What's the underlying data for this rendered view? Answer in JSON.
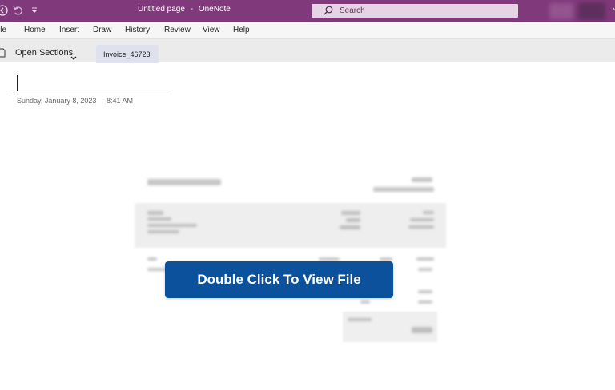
{
  "window": {
    "page_title": "Untitled page",
    "separator": "-",
    "app_name": "OneNote"
  },
  "search": {
    "placeholder": "Search"
  },
  "menu": {
    "items": [
      "ile",
      "Home",
      "Insert",
      "Draw",
      "History",
      "Review",
      "View",
      "Help"
    ]
  },
  "sections": {
    "open_sections_label": "Open Sections",
    "active_tab": "Invoice_46723"
  },
  "page": {
    "date": "Sunday, January 8, 2023",
    "time": "8:41 AM"
  },
  "cta": {
    "label": "Double Click To View File"
  },
  "colors": {
    "titlebar": "#80397b",
    "cta": "#0c519c",
    "section_tab": "#dfe1ef"
  }
}
